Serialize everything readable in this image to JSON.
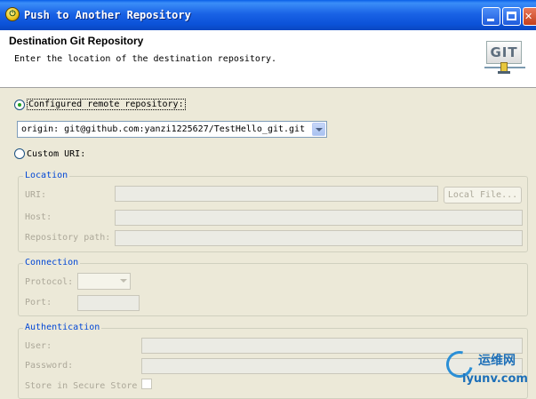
{
  "window": {
    "title": "Push to Another Repository",
    "icon": "eclipse-egit-icon",
    "controls": {
      "minimize": "minimize-icon",
      "maximize": "maximize-icon",
      "close": "close-icon"
    }
  },
  "header": {
    "title": "Destination Git Repository",
    "description": "Enter the location of the destination repository.",
    "logo_text": "GIT"
  },
  "remote": {
    "configured_label": "Configured remote repository:",
    "selected": "origin: git@github.com:yanzi1225627/TestHello_git.git",
    "custom_label": "Custom URI:",
    "configured_checked": true
  },
  "location": {
    "title": "Location",
    "uri_label": "URI:",
    "uri_value": "",
    "local_file_button": "Local File...",
    "host_label": "Host:",
    "host_value": "",
    "repo_path_label": "Repository path:",
    "repo_path_value": ""
  },
  "connection": {
    "title": "Connection",
    "protocol_label": "Protocol:",
    "protocol_value": "",
    "port_label": "Port:",
    "port_value": ""
  },
  "authentication": {
    "title": "Authentication",
    "user_label": "User:",
    "user_value": "",
    "password_label": "Password:",
    "password_value": "",
    "store_label": "Store in Secure Store",
    "store_checked": false
  },
  "watermark": {
    "cn_text": "运维网",
    "url_text": "iyunv.com"
  },
  "colors": {
    "title_bar": "#0b52d8",
    "group_title": "#0046d5",
    "disabled_text": "#aca899",
    "dialog_bg": "#ece9d8"
  }
}
